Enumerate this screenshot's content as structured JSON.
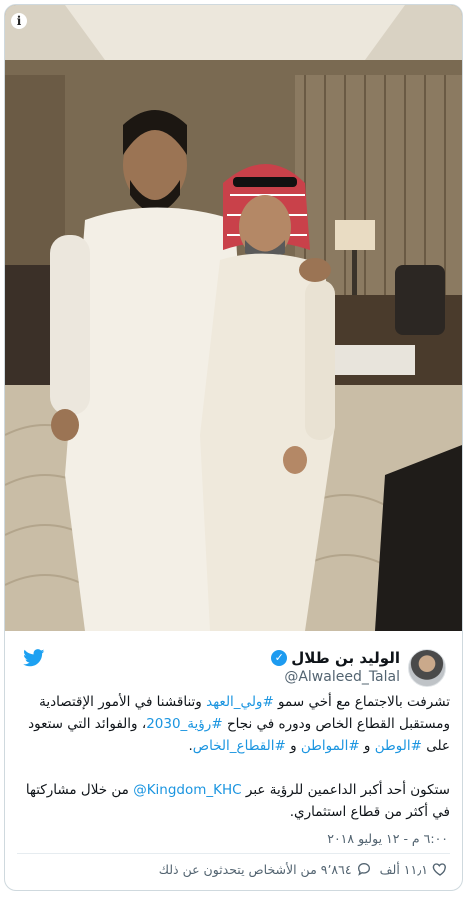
{
  "tweet": {
    "author": {
      "display_name": "الوليد بن طلال",
      "handle": "@Alwaleed_Talal",
      "verified": true
    },
    "text": {
      "p1_a": "تشرفت بالاجتماع مع أخي سمو ",
      "p1_tag1": "#ولي_العهد",
      "p1_b": " وتناقشنا في الأمور الإقتصادية ومستقبل القطاع الخاص ودوره في نجاح ",
      "p1_tag2": "#رؤية_2030",
      "p1_c": "، والفوائد التي ستعود على ",
      "p1_tag3": "#الوطن",
      "p1_d": " و ",
      "p1_tag4": "#المواطن",
      "p1_e": " و ",
      "p1_tag5": "#القطاع_الخاص",
      "p1_f": ".",
      "p2_a": "ستكون أحد أكبر الداعمين للرؤية عبر ",
      "p2_mention": "@Kingdom_KHC",
      "p2_b": " من خلال مشاركتها في أكثر من قطاع استثماري."
    },
    "timestamp": "٦:٠٠ م - ١٢ يوليو ٢٠١٨",
    "likes": "١١٫١ ألف",
    "replies_text": "٩٬٨٦٤ من الأشخاص يتحدثون عن ذلك"
  },
  "icons": {
    "info": "info-icon",
    "brand": "twitter-bird-icon",
    "verified": "verified-badge-icon",
    "like": "heart-icon",
    "reply": "speech-bubble-icon"
  },
  "colors": {
    "link": "#1b95e0",
    "verified": "#1d9bf0",
    "text": "#0f1419",
    "muted": "#536471"
  }
}
